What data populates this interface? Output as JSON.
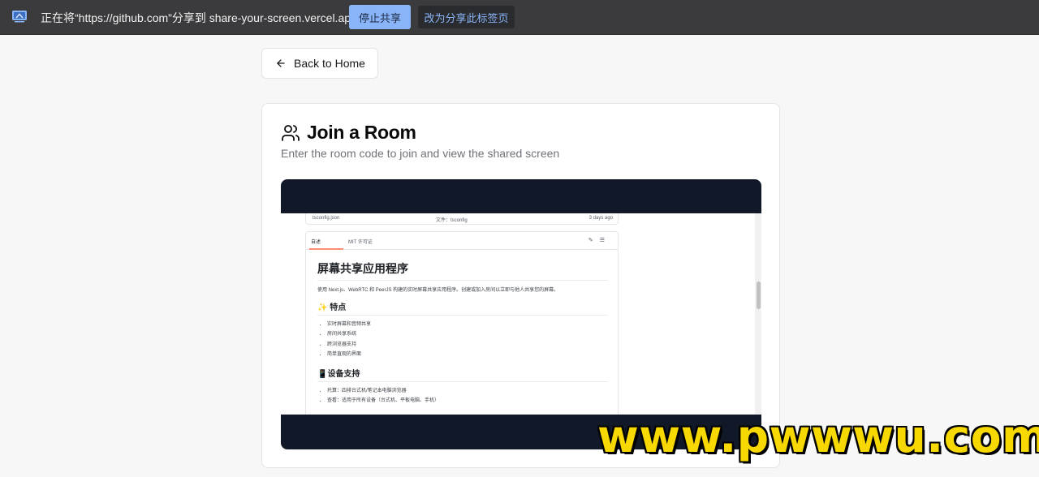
{
  "share_bar": {
    "icon": "screen-share-icon",
    "message": "正在将“https://github.com”分享到 share-your-screen.vercel.app",
    "stop_label": "停止共享",
    "share_tab_label": "改为分享此标签页"
  },
  "back": {
    "icon": "arrow-left-icon",
    "label": "Back to Home"
  },
  "card": {
    "icon": "users-icon",
    "title": "Join a Room",
    "description": "Enter the room code to join and view the shared screen"
  },
  "shared_screen": {
    "file_bar": {
      "file_name": "tsconfig.json",
      "commit_msg": "文件：tsconfig",
      "time": "3 days ago"
    },
    "tabs": [
      "自述",
      "MIT 许可证"
    ],
    "readme": {
      "title": "屏幕共享应用程序",
      "intro": "使用 Next.js、WebRTC 和 PeerJS 构建的实时屏幕共享应用程序。创建或加入房间以立即与他人共享您的屏幕。",
      "features_heading": "✨ 特点",
      "features": [
        "实时屏幕和音频共享",
        "房间共享系统",
        "跨浏览器支持",
        "简单直观的界面"
      ],
      "devices_heading": "📱设备支持",
      "devices": [
        "托算：四排台式机/笔记本电脑浏览器",
        "查看：适用于所有设备（台式机、平板电脑、手机）"
      ]
    }
  },
  "watermark": "www.pwwwu.com",
  "colors": {
    "share_bar_bg": "#3b3b3d",
    "stop_button": "#8ab4f8",
    "video_bg": "#111827",
    "watermark": "#f7d800"
  }
}
